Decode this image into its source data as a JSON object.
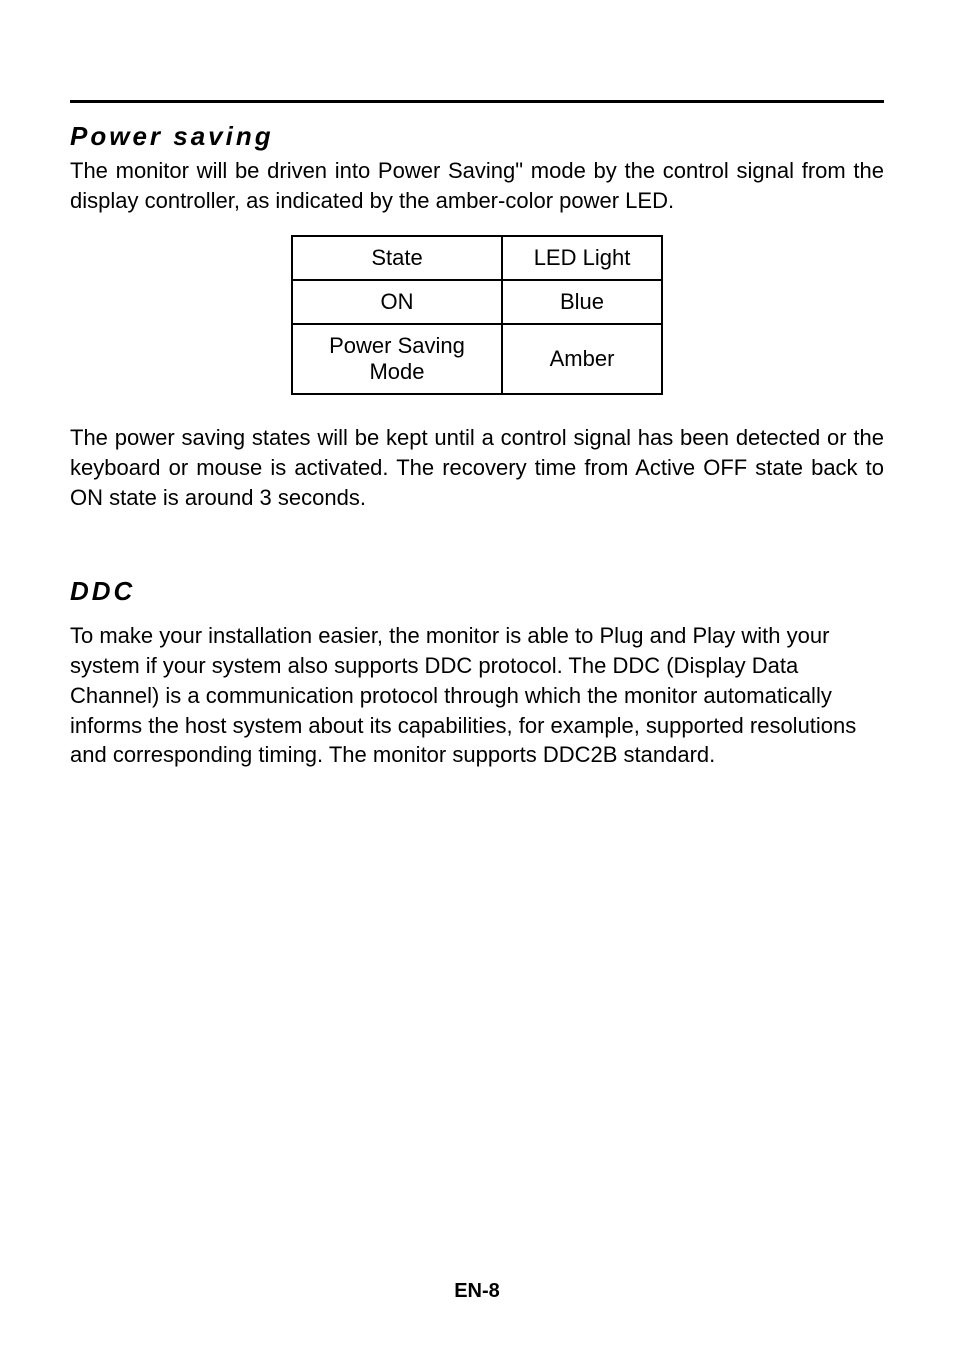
{
  "sections": {
    "power_saving": {
      "heading": "Power saving",
      "intro": "The monitor will be driven into Power Saving\" mode by the control signal from the display controller, as indicated by the amber-color power LED.",
      "table": {
        "header": {
          "state": "State",
          "led": "LED Light"
        },
        "rows": [
          {
            "state": "ON",
            "led": "Blue"
          },
          {
            "state": "Power Saving Mode",
            "led": "Amber"
          }
        ]
      },
      "after_table": "The power saving states will be kept until a control signal has been detected or the keyboard or mouse is activated. The recovery time from Active OFF state back to ON state is around 3 seconds."
    },
    "ddc": {
      "heading": "DDC",
      "body": "To make your installation easier, the monitor is able to Plug and Play with your system if your system also supports DDC protocol. The DDC (Display Data Channel) is a communication protocol through which the monitor automatically informs the host system  about its capabilities, for example, supported resolutions and corresponding timing. The monitor supports DDC2B standard."
    }
  },
  "footer": "EN-8"
}
